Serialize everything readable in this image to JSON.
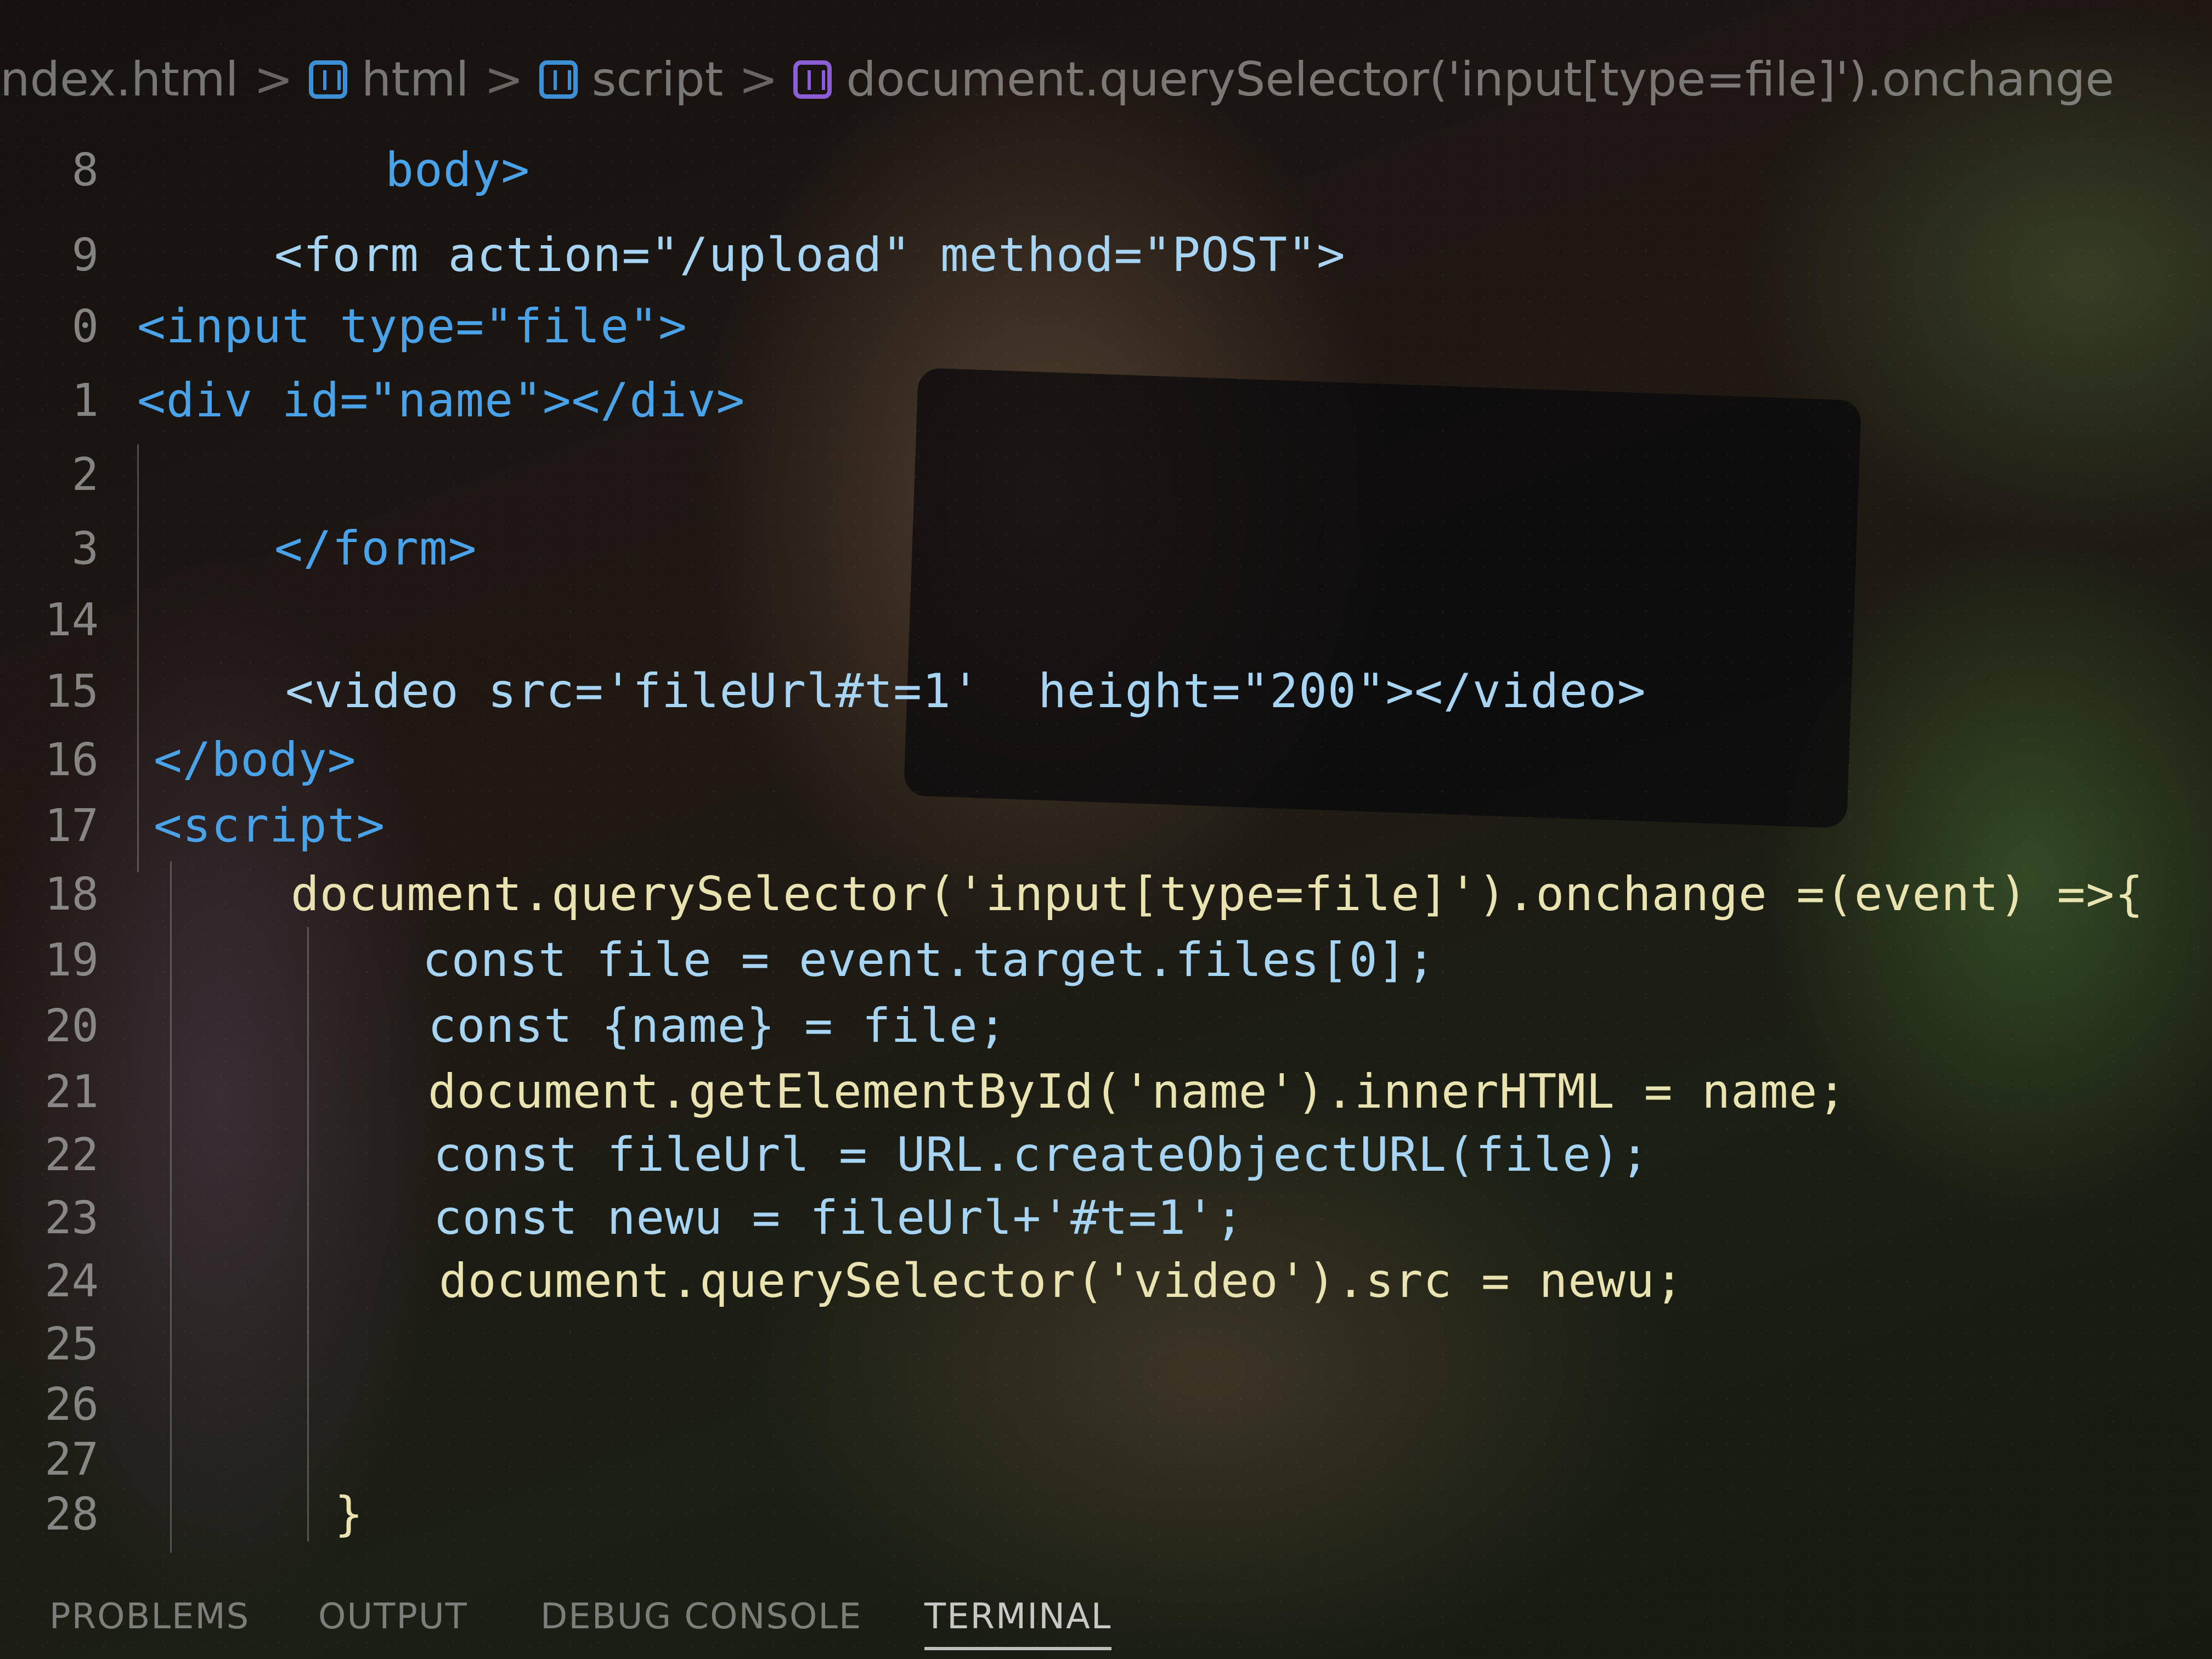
{
  "breadcrumb": {
    "items": [
      "ndex.html",
      "html",
      "script",
      "document.querySelector('input[type=file]').onchange"
    ],
    "separator": ">"
  },
  "editor": {
    "lines": [
      {
        "number": "8",
        "text": "body>"
      },
      {
        "number": "9",
        "text": "<form action=\"/upload\" method=\"POST\">"
      },
      {
        "number": "0",
        "text": "<input type=\"file\">"
      },
      {
        "number": "1",
        "text": "<div id=\"name\"></div>"
      },
      {
        "number": "2",
        "text": ""
      },
      {
        "number": "3",
        "text": "</form>"
      },
      {
        "number": "14",
        "text": ""
      },
      {
        "number": "15",
        "text": "<video src='fileUrl#t=1'  height=\"200\"></video>"
      },
      {
        "number": "16",
        "text": "</body>"
      },
      {
        "number": "17",
        "text": "<script>"
      },
      {
        "number": "18",
        "text": "document.querySelector('input[type=file]').onchange =(event) =>{"
      },
      {
        "number": "19",
        "text": "const file = event.target.files[0];"
      },
      {
        "number": "20",
        "text": "const {name} = file;"
      },
      {
        "number": "21",
        "text": "document.getElementById('name').innerHTML = name;"
      },
      {
        "number": "22",
        "text": "const fileUrl = URL.createObjectURL(file);"
      },
      {
        "number": "23",
        "text": "const newu = fileUrl+'#t=1';"
      },
      {
        "number": "24",
        "text": "document.querySelector('video').src = newu;"
      },
      {
        "number": "25",
        "text": ""
      },
      {
        "number": "26",
        "text": ""
      },
      {
        "number": "27",
        "text": ""
      },
      {
        "number": "28",
        "text": "}"
      }
    ]
  },
  "panel": {
    "tabs": [
      "PROBLEMS",
      "OUTPUT",
      "DEBUG CONSOLE",
      "TERMINAL"
    ],
    "active_tab": "TERMINAL"
  },
  "colors": {
    "tag": "#4aa3e8",
    "attribute": "#a6d4f2",
    "string": "#d6a87c",
    "function": "#e8e3b0",
    "number": "#b5cea8"
  }
}
